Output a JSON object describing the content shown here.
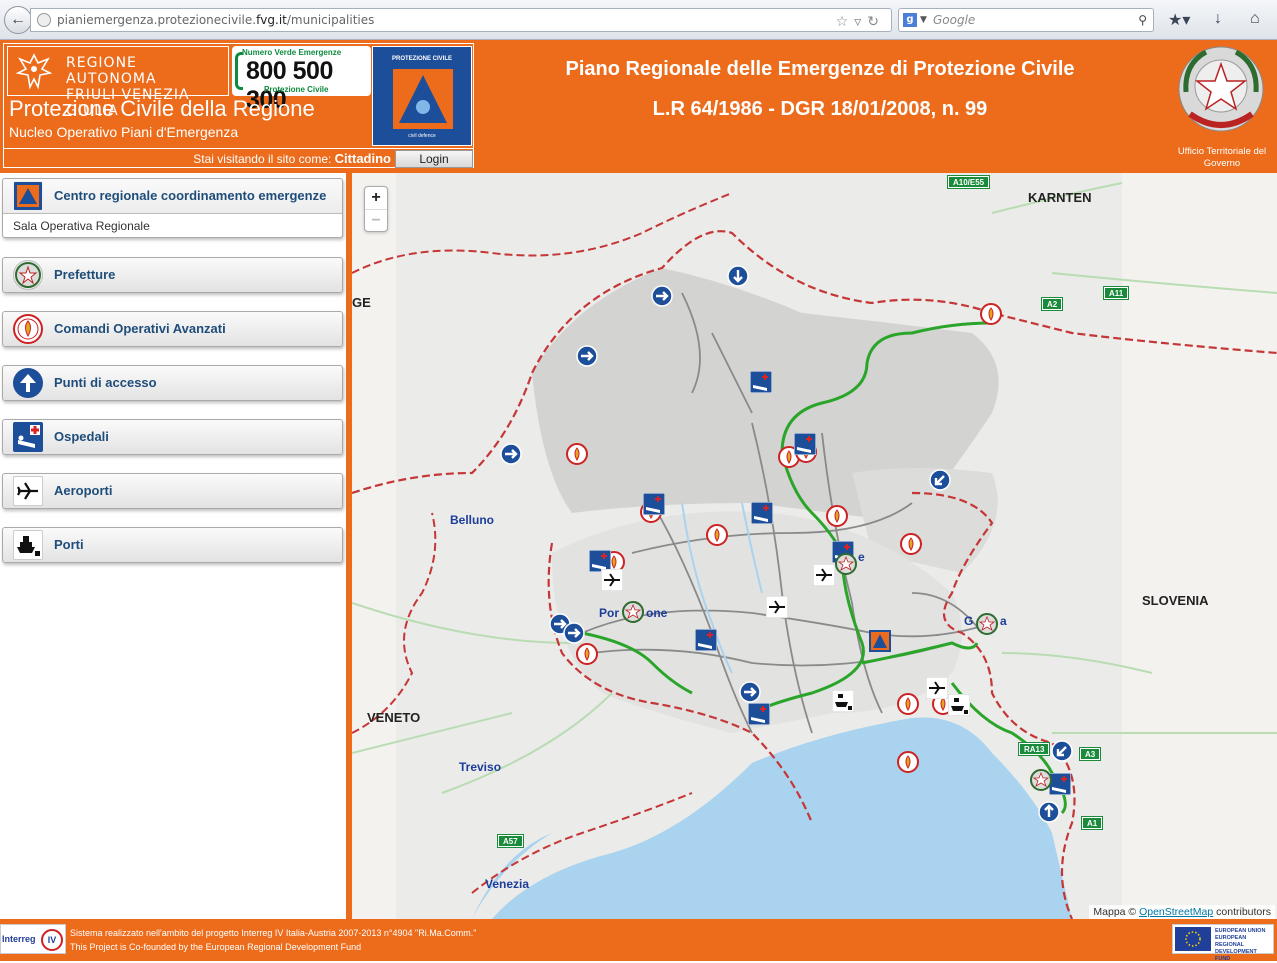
{
  "browser": {
    "url_prefix": "pianiemergenza.protezionecivile.",
    "url_domain": "fvg.it",
    "url_path": "/municipalities",
    "search_placeholder": "Google"
  },
  "header": {
    "region_line1": "REGIONE AUTONOMA",
    "region_line2": "FRIULI VENEZIA GIULIA",
    "hotline_title": "Numero Verde Emergenze",
    "hotline_number": "800 500 300",
    "hotline_sub": "Protezione Civile",
    "pc_logo_title": "PROTEZIONE CIVILE",
    "pc_logo_bottom": "civil defence",
    "site_title": "Protezione Civile della Regione",
    "site_subtitle": "Nucleo Operativo Piani d'Emergenza",
    "visit_prefix": "Stai visitando il sito come:",
    "visit_role": "Cittadino",
    "login_label": "Login",
    "plan_title": "Piano Regionale delle Emergenze di Protezione Civile",
    "plan_subtitle": "L.R 64/1986 - DGR 18/01/2008, n. 99",
    "office_label": "Ufficio Territoriale del Governo",
    "colors": {
      "orange": "#ec6c1c",
      "green": "#0d8b3e",
      "blue": "#1c4e9a"
    }
  },
  "sidebar": {
    "items": [
      {
        "label": "Centro regionale coordinamento emergenze",
        "icon": "civil-protection-icon",
        "expanded": true,
        "sub_label": "Sala Operativa Regionale"
      },
      {
        "label": "Prefetture",
        "icon": "prefecture-emblem-icon"
      },
      {
        "label": "Comandi Operativi Avanzati",
        "icon": "firefighter-badge-icon"
      },
      {
        "label": "Punti di accesso",
        "icon": "arrow-up-icon"
      },
      {
        "label": "Ospedali",
        "icon": "hospital-bed-icon"
      },
      {
        "label": "Aeroporti",
        "icon": "airplane-icon"
      },
      {
        "label": "Porti",
        "icon": "ship-icon"
      }
    ]
  },
  "map": {
    "zoom_in": "+",
    "zoom_out": "−",
    "labels": {
      "karnten": "KARNTEN",
      "slovenia": "SLOVENIA",
      "veneto": "VENETO",
      "ge": "GE"
    },
    "cities": {
      "belluno": "Belluno",
      "treviso": "Treviso",
      "venezia": "Venezia",
      "pordenone_a": "Por",
      "pordenone_b": "one",
      "gorizia_a": "G",
      "gorizia_b": "a",
      "udine_fragment": "e"
    },
    "highways": [
      "A10/E55",
      "A2",
      "A11",
      "A3",
      "RA13",
      "A57",
      "A1"
    ],
    "attribution_prefix": "Mappa ©",
    "attribution_link": "OpenStreetMap",
    "attribution_suffix": "contributors"
  },
  "footer": {
    "line1": "Sistema realizzato nell'ambito del progetto Interreg IV Italia-Austria 2007-2013 n°4904 \"Ri.Ma.Comm.\"",
    "line2": "This Project is Co-founded by the European Regional Development Fund",
    "interreg_label": "Interreg",
    "interreg_num": "IV",
    "eu_line1": "EUROPEAN UNION",
    "eu_line2": "EUROPEAN REGIONAL",
    "eu_line3": "DEVELOPMENT FUND"
  }
}
